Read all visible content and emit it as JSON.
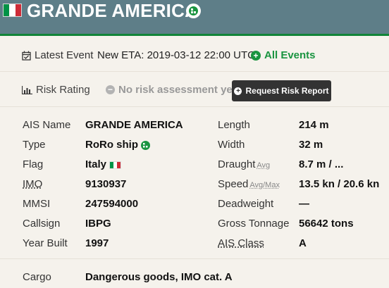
{
  "header": {
    "title": "GRANDE AMERICA",
    "flag_icon": "italy-flag-icon",
    "flag_colors": [
      "#009246",
      "#ffffff",
      "#ce2b37"
    ],
    "type_icon": "roro-ship-icon"
  },
  "latest_event": {
    "label": "Latest Event",
    "value": "New ETA: 2019-03-12 22:00 UTC",
    "link": "All Events"
  },
  "risk": {
    "label": "Risk Rating",
    "status": "No risk assessment yet",
    "button": "Request Risk Report"
  },
  "details": {
    "left": [
      {
        "label": "AIS Name",
        "value": "GRANDE AMERICA"
      },
      {
        "label": "Type",
        "value": "RoRo ship"
      },
      {
        "label": "Flag",
        "value": "Italy"
      },
      {
        "label": "IMO",
        "value": "9130937"
      },
      {
        "label": "MMSI",
        "value": "247594000"
      },
      {
        "label": "Callsign",
        "value": "IBPG"
      },
      {
        "label": "Year Built",
        "value": "1997"
      }
    ],
    "right": [
      {
        "label": "Length",
        "sub": "",
        "value": "214 m"
      },
      {
        "label": "Width",
        "sub": "",
        "value": "32 m"
      },
      {
        "label": "Draught",
        "sub": "Avg",
        "value": "8.7 m / ..."
      },
      {
        "label": "Speed",
        "sub": "Avg/Max",
        "value": "13.5 kn / 20.6 kn"
      },
      {
        "label": "Deadweight",
        "sub": "",
        "value": "—"
      },
      {
        "label": "Gross Tonnage",
        "sub": "",
        "value": "56642 tons"
      },
      {
        "label": "AIS Class",
        "sub": "",
        "value": "A"
      }
    ]
  },
  "cargo": {
    "label": "Cargo",
    "value": "Dangerous goods, IMO cat. A"
  },
  "colors": {
    "header_bg": "#5e7e88",
    "accent_green": "#1a9440",
    "button_bg": "#333333"
  }
}
